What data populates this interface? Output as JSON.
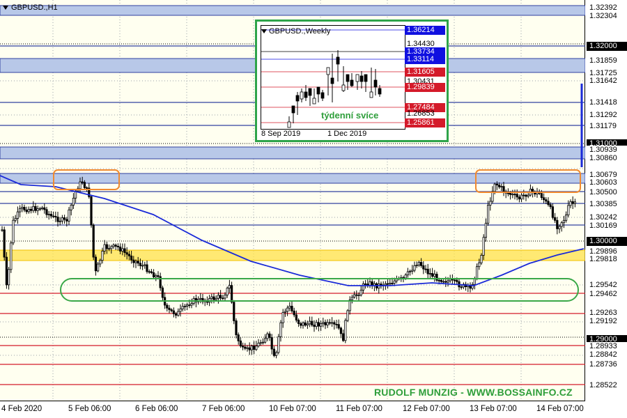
{
  "chart": {
    "title": "GBPUSD.,H1",
    "watermark": "RUDOLF MUNZIG - WWW.BOSSAINFO.CZ",
    "price_axis": [
      {
        "text": "1.32392",
        "style": "plain"
      },
      {
        "text": "1.32304",
        "style": "plain"
      },
      {
        "text": "1.32000",
        "style": "hl"
      },
      {
        "text": "1.31859",
        "style": "plain"
      },
      {
        "text": "1.31725",
        "style": "plain"
      },
      {
        "text": "1.31642",
        "style": "plain"
      },
      {
        "text": "1.31418",
        "style": "plain"
      },
      {
        "text": "1.31292",
        "style": "plain"
      },
      {
        "text": "1.31179",
        "style": "plain"
      },
      {
        "text": "1.31000",
        "style": "hl"
      },
      {
        "text": "1.30939",
        "style": "plain"
      },
      {
        "text": "1.30860",
        "style": "plain"
      },
      {
        "text": "1.30679",
        "style": "plain"
      },
      {
        "text": "1.30603",
        "style": "plain"
      },
      {
        "text": "1.30500",
        "style": "plain"
      },
      {
        "text": "1.30385",
        "style": "plain"
      },
      {
        "text": "1.30242",
        "style": "plain"
      },
      {
        "text": "1.30169",
        "style": "plain"
      },
      {
        "text": "1.30000",
        "style": "hl"
      },
      {
        "text": "1.29896",
        "style": "plain"
      },
      {
        "text": "1.29818",
        "style": "plain"
      },
      {
        "text": "1.29542",
        "style": "plain"
      },
      {
        "text": "1.29462",
        "style": "plain"
      },
      {
        "text": "1.29263",
        "style": "plain"
      },
      {
        "text": "1.29192",
        "style": "plain"
      },
      {
        "text": "1.29000",
        "style": "hl"
      },
      {
        "text": "1.28933",
        "style": "plain"
      },
      {
        "text": "1.28842",
        "style": "plain"
      },
      {
        "text": "1.28736",
        "style": "plain"
      },
      {
        "text": "1.28522",
        "style": "plain"
      }
    ],
    "time_axis": [
      "4 Feb 2020",
      "5 Feb 06:00",
      "6 Feb 06:00",
      "7 Feb 06:00",
      "10 Feb 07:00",
      "11 Feb 07:00",
      "12 Feb 07:00",
      "13 Feb 07:00",
      "14 Feb 07:00"
    ],
    "colors": {
      "zone_blue": "#b8c8e8",
      "zone_border": "#3040a0",
      "yellow_zone": "#ffe14a",
      "red_line": "#d41a2a",
      "ma_line": "#1a2ad8",
      "orange_box": "#f08a30",
      "green_ellipse": "#3aa848",
      "candle": "#000000"
    }
  },
  "inset": {
    "title": "GBPUSD.,Weekly",
    "caption": "týdenní svíce",
    "labels": [
      {
        "text": "1.36214",
        "style": "blue"
      },
      {
        "text": "1.34430",
        "style": "plain"
      },
      {
        "text": "1.33734",
        "style": "blue"
      },
      {
        "text": "1.33114",
        "style": "blue"
      },
      {
        "text": "1.31605",
        "style": "red"
      },
      {
        "text": "1.30431",
        "style": "plain"
      },
      {
        "text": "1.29839",
        "style": "red"
      },
      {
        "text": "1.27484",
        "style": "red"
      },
      {
        "text": "1.26853",
        "style": "plain"
      },
      {
        "text": "1.25861",
        "style": "red"
      }
    ],
    "time_axis": [
      "8 Sep 2019",
      "1 Dec 2019"
    ]
  }
}
